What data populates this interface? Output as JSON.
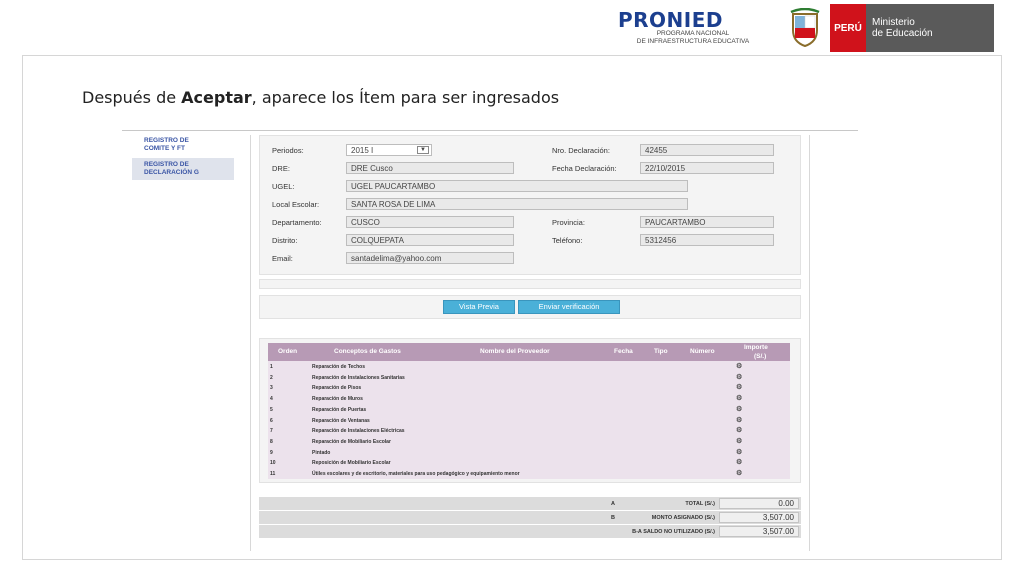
{
  "header": {
    "pronied_title": "PRONIED",
    "pronied_sub1": "PROGRAMA NACIONAL",
    "pronied_sub2": "DE INFRAESTRUCTURA EDUCATIVA",
    "peru_label": "PERÚ",
    "ministerio_line1": "Ministerio",
    "ministerio_line2": "de Educación"
  },
  "caption": {
    "prefix": "Después de ",
    "bold": "Aceptar",
    "suffix": ", aparece los Ítem para ser ingresados"
  },
  "sidebar": {
    "items": [
      {
        "label_1": "REGISTRO DE",
        "label_2": "COMITE Y FT"
      },
      {
        "label_1": "REGISTRO DE",
        "label_2": "DECLARACIÓN G"
      }
    ]
  },
  "form": {
    "periodos_label": "Periodos:",
    "periodos_value": "2015 I",
    "nro_declaracion_label": "Nro. Declaración:",
    "nro_declaracion_value": "42455",
    "dre_label": "DRE:",
    "dre_value": "DRE Cusco",
    "fecha_declaracion_label": "Fecha Declaración:",
    "fecha_declaracion_value": "22/10/2015",
    "ugel_label": "UGEL:",
    "ugel_value": "UGEL PAUCARTAMBO",
    "local_escolar_label": "Local Escolar:",
    "local_escolar_value": "SANTA ROSA DE LIMA",
    "departamento_label": "Departamento:",
    "departamento_value": "CUSCO",
    "provincia_label": "Provincia:",
    "provincia_value": "PAUCARTAMBO",
    "distrito_label": "Distrito:",
    "distrito_value": "COLQUEPATA",
    "telefono_label": "Teléfono:",
    "telefono_value": "5312456",
    "email_label": "Email:",
    "email_value": "santadelima@yahoo.com"
  },
  "buttons": {
    "vista_previa": "Vista Previa",
    "enviar_verificacion": "Enviar verificación"
  },
  "table": {
    "headers": {
      "orden": "Orden",
      "conceptos": "Conceptos de Gastos",
      "proveedor": "Nombre del Proveedor",
      "fecha": "Fecha",
      "tipo": "Tipo",
      "numero": "Número",
      "importe_1": "Importe",
      "importe_2": "(S/.)"
    },
    "rows": [
      {
        "num": "1",
        "concept": "Reparación de Techos"
      },
      {
        "num": "2",
        "concept": "Reparación de Instalaciones Sanitarias"
      },
      {
        "num": "3",
        "concept": "Reparación de Pisos"
      },
      {
        "num": "4",
        "concept": "Reparación de Muros"
      },
      {
        "num": "5",
        "concept": "Reparación de Puertas"
      },
      {
        "num": "6",
        "concept": "Reparación de Ventanas"
      },
      {
        "num": "7",
        "concept": "Reparación de Instalaciones Eléctricas"
      },
      {
        "num": "8",
        "concept": "Reparación de Mobiliario Escolar"
      },
      {
        "num": "9",
        "concept": "Pintado"
      },
      {
        "num": "10",
        "concept": "Reposición de Mobiliario Escolar"
      },
      {
        "num": "11",
        "concept": "Útiles escolares y de escritorio, materiales para uso pedagógico y equipamiento menor"
      }
    ]
  },
  "totals": {
    "total_letter": "A",
    "total_label": "TOTAL (S/.)",
    "total_value": "0.00",
    "monto_letter": "B",
    "monto_label": "MONTO ASIGNADO (S/.)",
    "monto_value": "3,507.00",
    "saldo_label": "B-A SALDO NO UTILIZADO (S/.)",
    "saldo_value": "3,507.00"
  },
  "colors": {
    "pronied_blue": "#1c3f8f",
    "peru_red": "#d0121b",
    "button_blue": "#4ab0d8",
    "table_header": "#b79ab5",
    "table_body": "#ece2ec"
  }
}
